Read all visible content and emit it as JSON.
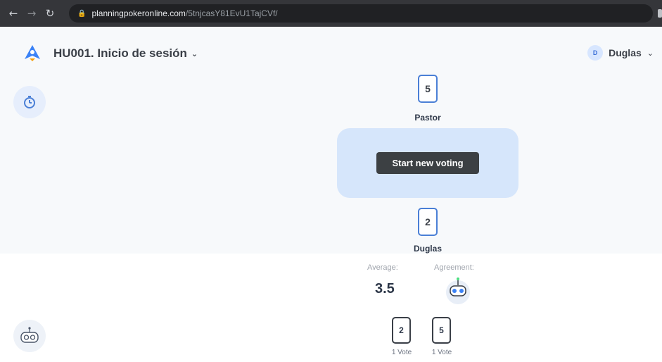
{
  "browser": {
    "url_domain": "planningpokeronline.com",
    "url_path": "/5tnjcasY81EvU1TajCVf/",
    "icons": [
      "back-arrow-icon",
      "forward-arrow-icon",
      "reload-icon",
      "lock-icon"
    ]
  },
  "header": {
    "game_title": "HU001. Inicio de sesión",
    "user": {
      "initial": "D",
      "name": "Duglas"
    }
  },
  "table": {
    "start_button_label": "Start new voting",
    "players": [
      {
        "name": "Pastor",
        "card": "5"
      },
      {
        "name": "Duglas",
        "card": "2"
      }
    ]
  },
  "results": {
    "average_label": "Average:",
    "average_value": "3.5",
    "agreement_label": "Agreement:",
    "vote_cards": [
      {
        "value": "2",
        "count_label": "1 Vote"
      },
      {
        "value": "5",
        "count_label": "1 Vote"
      }
    ]
  },
  "colors": {
    "accent": "#4a7fd6",
    "table": "#d6e6fb",
    "button": "#3c4043",
    "browser_bar": "#35363a"
  }
}
